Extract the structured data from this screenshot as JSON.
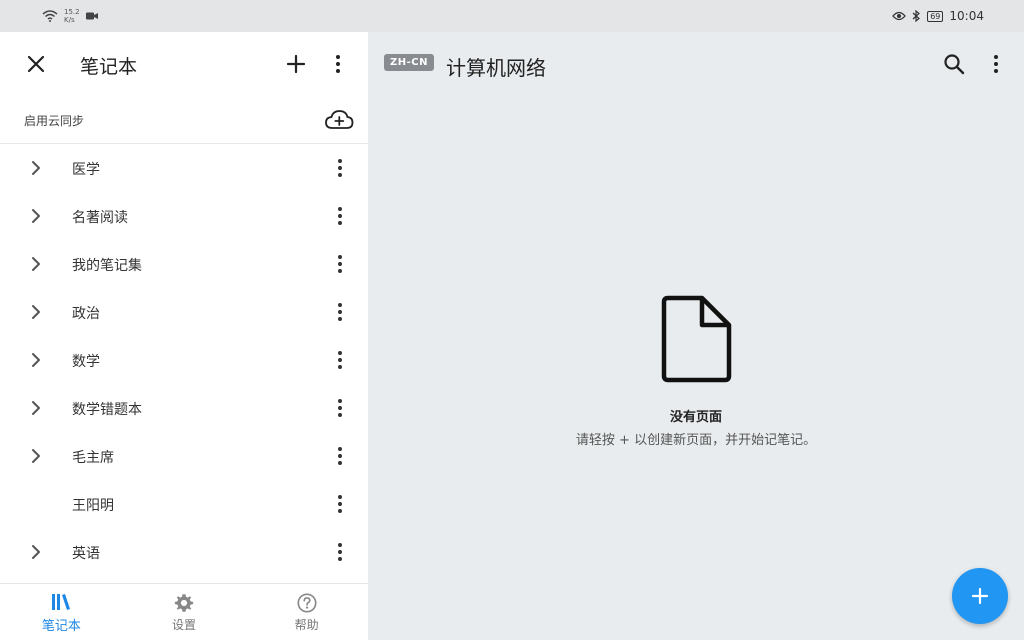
{
  "status_bar": {
    "net_speed_value": "15.2",
    "net_speed_unit": "K/s",
    "battery": "69",
    "time": "10:04"
  },
  "drawer": {
    "title": "笔记本",
    "cloud_sync_label": "启用云同步",
    "notebooks": [
      {
        "label": "医学",
        "expandable": true
      },
      {
        "label": "名著阅读",
        "expandable": true
      },
      {
        "label": "我的笔记集",
        "expandable": true
      },
      {
        "label": "政治",
        "expandable": true
      },
      {
        "label": "数学",
        "expandable": true
      },
      {
        "label": "数学错题本",
        "expandable": true
      },
      {
        "label": "毛主席",
        "expandable": true
      },
      {
        "label": "王阳明",
        "expandable": false
      },
      {
        "label": "英语",
        "expandable": true
      }
    ]
  },
  "bottom_nav": {
    "notebooks": "笔记本",
    "settings": "设置",
    "help": "帮助"
  },
  "main": {
    "lang_badge": "ZH-CN",
    "title": "计算机网络",
    "empty_title": "没有页面",
    "empty_hint": "请轻按 + 以创建新页面，并开始记笔记。"
  },
  "colors": {
    "accent": "#2196f3",
    "nav_active": "#1e88e5",
    "main_background": "#e8ecee",
    "status_bar": "#e3e5e7"
  }
}
